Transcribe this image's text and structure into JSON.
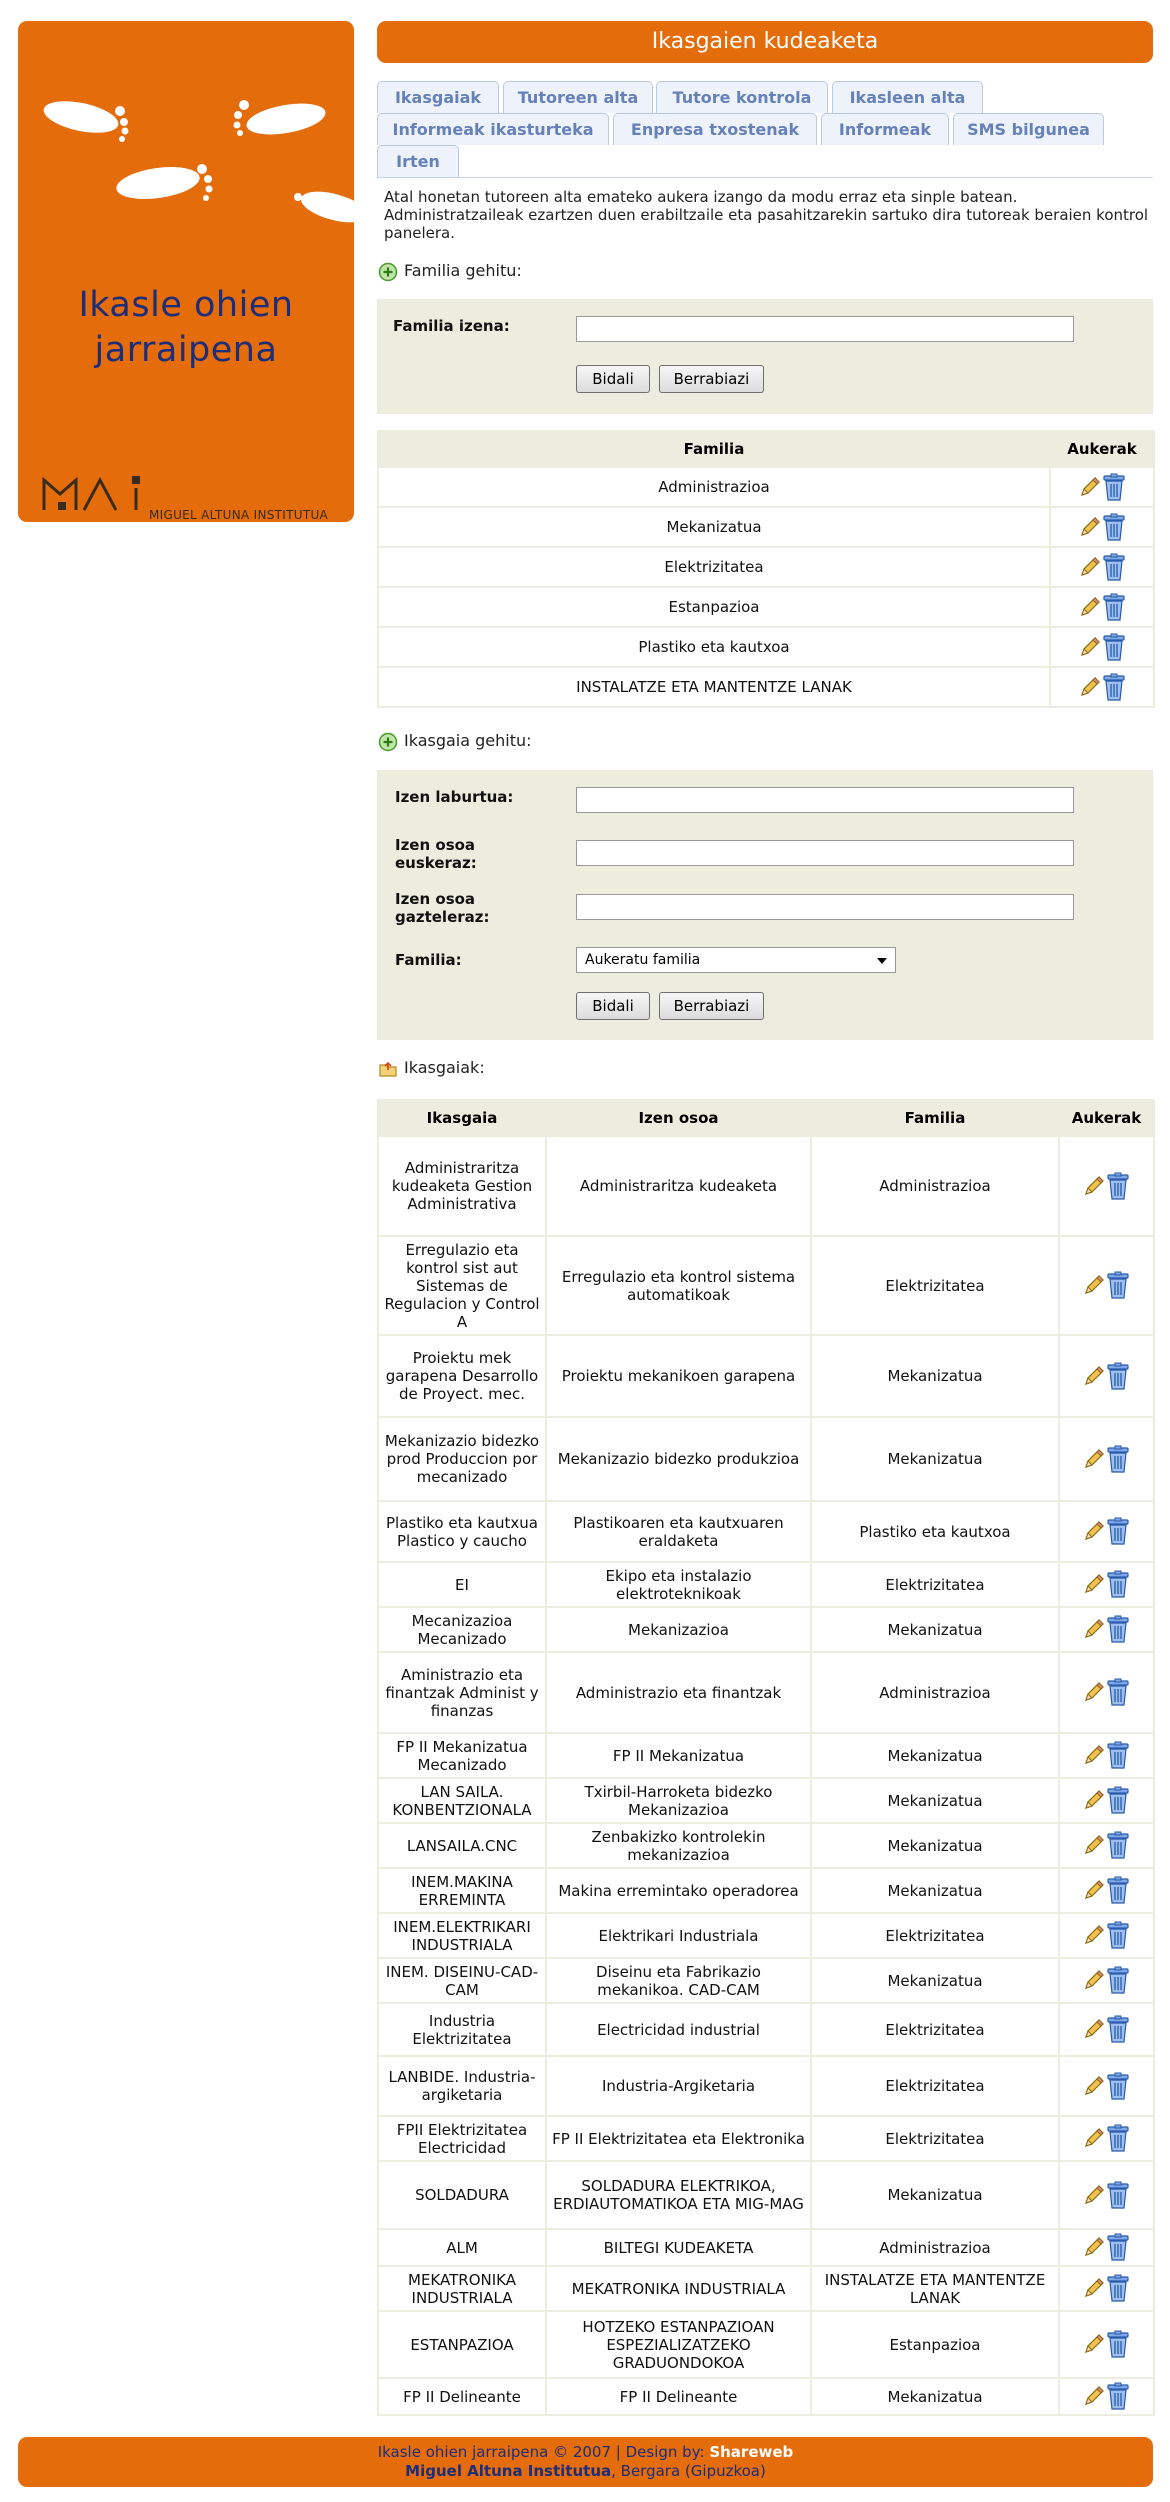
{
  "brand": {
    "site_name_line1": "Ikasle ohien",
    "site_name_line2": "jarraipena",
    "school": "MIGUEL ALTUNA INSTITUTUA"
  },
  "header": {
    "title": "Ikasgaien kudeaketa"
  },
  "tabs": [
    {
      "label": "Ikasgaiak"
    },
    {
      "label": "Tutoreen alta"
    },
    {
      "label": "Tutore kontrola"
    },
    {
      "label": "Ikasleen alta"
    },
    {
      "label": "Informeak ikasturteka"
    },
    {
      "label": "Enpresa txostenak"
    },
    {
      "label": "Informeak"
    },
    {
      "label": "SMS bilgunea"
    },
    {
      "label": "Irten"
    }
  ],
  "intro": "Atal honetan tutoreen alta emateko aukera izango da modu erraz eta sinple batean. Administratzaileak ezartzen duen erabiltzaile eta pasahitzarekin sartuko dira tutoreak beraien kontrol panelera.",
  "familia_form": {
    "heading": "Familia gehitu:",
    "label": "Familia izena:",
    "value": "",
    "submit": "Bidali",
    "reset": "Berrabiazi"
  },
  "familia_table": {
    "headers": [
      "Familia",
      "Aukerak"
    ],
    "rows": [
      "Administrazioa",
      "Mekanizatua",
      "Elektrizitatea",
      "Estanpazioa",
      "Plastiko eta kautxoa",
      "INSTALATZE ETA MANTENTZE LANAK"
    ]
  },
  "ikasgaia_form": {
    "heading": "Ikasgaia gehitu:",
    "label_short": "Izen laburtua:",
    "label_eu_1": "Izen osoa",
    "label_eu_2": "euskeraz:",
    "label_es_1": "Izen osoa",
    "label_es_2": "gazteleraz:",
    "label_familia": "Familia:",
    "select_value": "Aukeratu familia",
    "submit": "Bidali",
    "reset": "Berrabiazi"
  },
  "ikasgaiak_table": {
    "heading": "Ikasgaiak:",
    "headers": [
      "Ikasgaia",
      "Izen osoa",
      "Familia",
      "Aukerak"
    ],
    "rows": [
      {
        "ikasgaia": "Administraritza kudeaketa Gestion Administrativa",
        "izen": "Administraritza kudeaketa",
        "familia": "Administrazioa"
      },
      {
        "ikasgaia": "Erregulazio eta kontrol sist aut Sistemas de Regulacion y Control A",
        "izen": "Erregulazio eta kontrol sistema automatikoak",
        "familia": "Elektrizitatea"
      },
      {
        "ikasgaia": "Proiektu mek garapena Desarrollo de Proyect. mec.",
        "izen": "Proiektu mekanikoen garapena",
        "familia": "Mekanizatua"
      },
      {
        "ikasgaia": "Mekanizazio bidezko prod Produccion por mecanizado",
        "izen": "Mekanizazio bidezko produkzioa",
        "familia": "Mekanizatua"
      },
      {
        "ikasgaia": "Plastiko eta kautxua Plastico y caucho",
        "izen": "Plastikoaren eta kautxuaren eraldaketa",
        "familia": "Plastiko eta kautxoa"
      },
      {
        "ikasgaia": "EI",
        "izen": "Ekipo eta instalazio elektroteknikoak",
        "familia": "Elektrizitatea"
      },
      {
        "ikasgaia": "Mecanizazioa Mecanizado",
        "izen": "Mekanizazioa",
        "familia": "Mekanizatua"
      },
      {
        "ikasgaia": "Aministrazio eta finantzak Administ y finanzas",
        "izen": "Administrazio eta finantzak",
        "familia": "Administrazioa"
      },
      {
        "ikasgaia": "FP II Mekanizatua Mecanizado",
        "izen": "FP II Mekanizatua",
        "familia": "Mekanizatua"
      },
      {
        "ikasgaia": "LAN SAILA. KONBENTZIONALA",
        "izen": "Txirbil-Harroketa bidezko Mekanizazioa",
        "familia": "Mekanizatua"
      },
      {
        "ikasgaia": "LANSAILA.CNC",
        "izen": "Zenbakizko kontrolekin mekanizazioa",
        "familia": "Mekanizatua"
      },
      {
        "ikasgaia": "INEM.MAKINA ERREMINTA",
        "izen": "Makina erremintako operadorea",
        "familia": "Mekanizatua"
      },
      {
        "ikasgaia": "INEM.ELEKTRIKARI INDUSTRIALA",
        "izen": "Elektrikari Industriala",
        "familia": "Elektrizitatea"
      },
      {
        "ikasgaia": "INEM. DISEINU-CAD-CAM",
        "izen": "Diseinu eta Fabrikazio mekanikoa. CAD-CAM",
        "familia": "Mekanizatua"
      },
      {
        "ikasgaia": "Industria Elektrizitatea",
        "izen": "Electricidad industrial",
        "familia": "Elektrizitatea"
      },
      {
        "ikasgaia": "LANBIDE. Industria-argiketaria",
        "izen": "Industria-Argiketaria",
        "familia": "Elektrizitatea"
      },
      {
        "ikasgaia": "FPII Elektrizitatea Electricidad",
        "izen": "FP II Elektrizitatea eta Elektronika",
        "familia": "Elektrizitatea"
      },
      {
        "ikasgaia": "SOLDADURA",
        "izen": "SOLDADURA ELEKTRIKOA, ERDIAUTOMATIKOA ETA MIG-MAG",
        "familia": "Mekanizatua"
      },
      {
        "ikasgaia": "ALM",
        "izen": "BILTEGI KUDEAKETA",
        "familia": "Administrazioa"
      },
      {
        "ikasgaia": "MEKATRONIKA INDUSTRIALA",
        "izen": "MEKATRONIKA INDUSTRIALA",
        "familia": "INSTALATZE ETA MANTENTZE LANAK"
      },
      {
        "ikasgaia": "ESTANPAZIOA",
        "izen": "HOTZEKO ESTANPAZIOAN ESPEZIALIZATZEKO GRADUONDOKOA",
        "familia": "Estanpazioa"
      },
      {
        "ikasgaia": "FP II Delineante",
        "izen": "FP II Delineante",
        "familia": "Mekanizatua"
      }
    ]
  },
  "footer": {
    "line1_text": "Ikasle ohien jarraipena © 2007 | Design by:",
    "line1_brand": "Shareweb",
    "line2_brand": "Miguel Altuna Institutua",
    "line2_text": ", Bergara (Gipuzkoa)"
  },
  "colors": {
    "accent": "#e46c0a",
    "brand_text": "#1d2d7a",
    "tab_text": "#6581b8",
    "form_bg": "#ececdf"
  },
  "icons": [
    "footprint-icon",
    "add-icon",
    "folder-icon",
    "edit-pencil-icon",
    "delete-trash-icon",
    "dropdown-arrow-icon"
  ]
}
